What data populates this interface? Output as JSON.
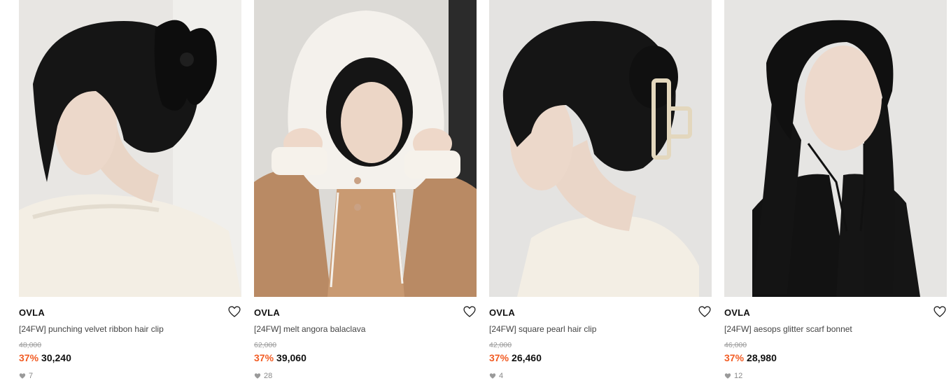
{
  "colors": {
    "discount": "#f25c24",
    "price": "#111111",
    "original_price": "#9a9a9a"
  },
  "products": [
    {
      "image_alt": "woman with black velvet ribbon hair clip",
      "brand": "OVLA",
      "name": "[24FW] punching velvet ribbon hair clip",
      "original_price": "48,000",
      "discount": "37%",
      "price": "30,240",
      "likes": "7",
      "wish_icon": "heart-outline-icon"
    },
    {
      "image_alt": "woman wearing white angora balaclava",
      "brand": "OVLA",
      "name": "[24FW] melt angora balaclava",
      "original_price": "62,000",
      "discount": "37%",
      "price": "39,060",
      "likes": "28",
      "wish_icon": "heart-outline-icon"
    },
    {
      "image_alt": "woman with square pearl hair clip",
      "brand": "OVLA",
      "name": "[24FW] square pearl hair clip",
      "original_price": "42,000",
      "discount": "37%",
      "price": "26,460",
      "likes": "4",
      "wish_icon": "heart-outline-icon"
    },
    {
      "image_alt": "woman wearing black glitter scarf bonnet",
      "brand": "OVLA",
      "name": "[24FW] aesops glitter scarf bonnet",
      "original_price": "46,000",
      "discount": "37%",
      "price": "28,980",
      "likes": "12",
      "wish_icon": "heart-outline-icon"
    }
  ]
}
